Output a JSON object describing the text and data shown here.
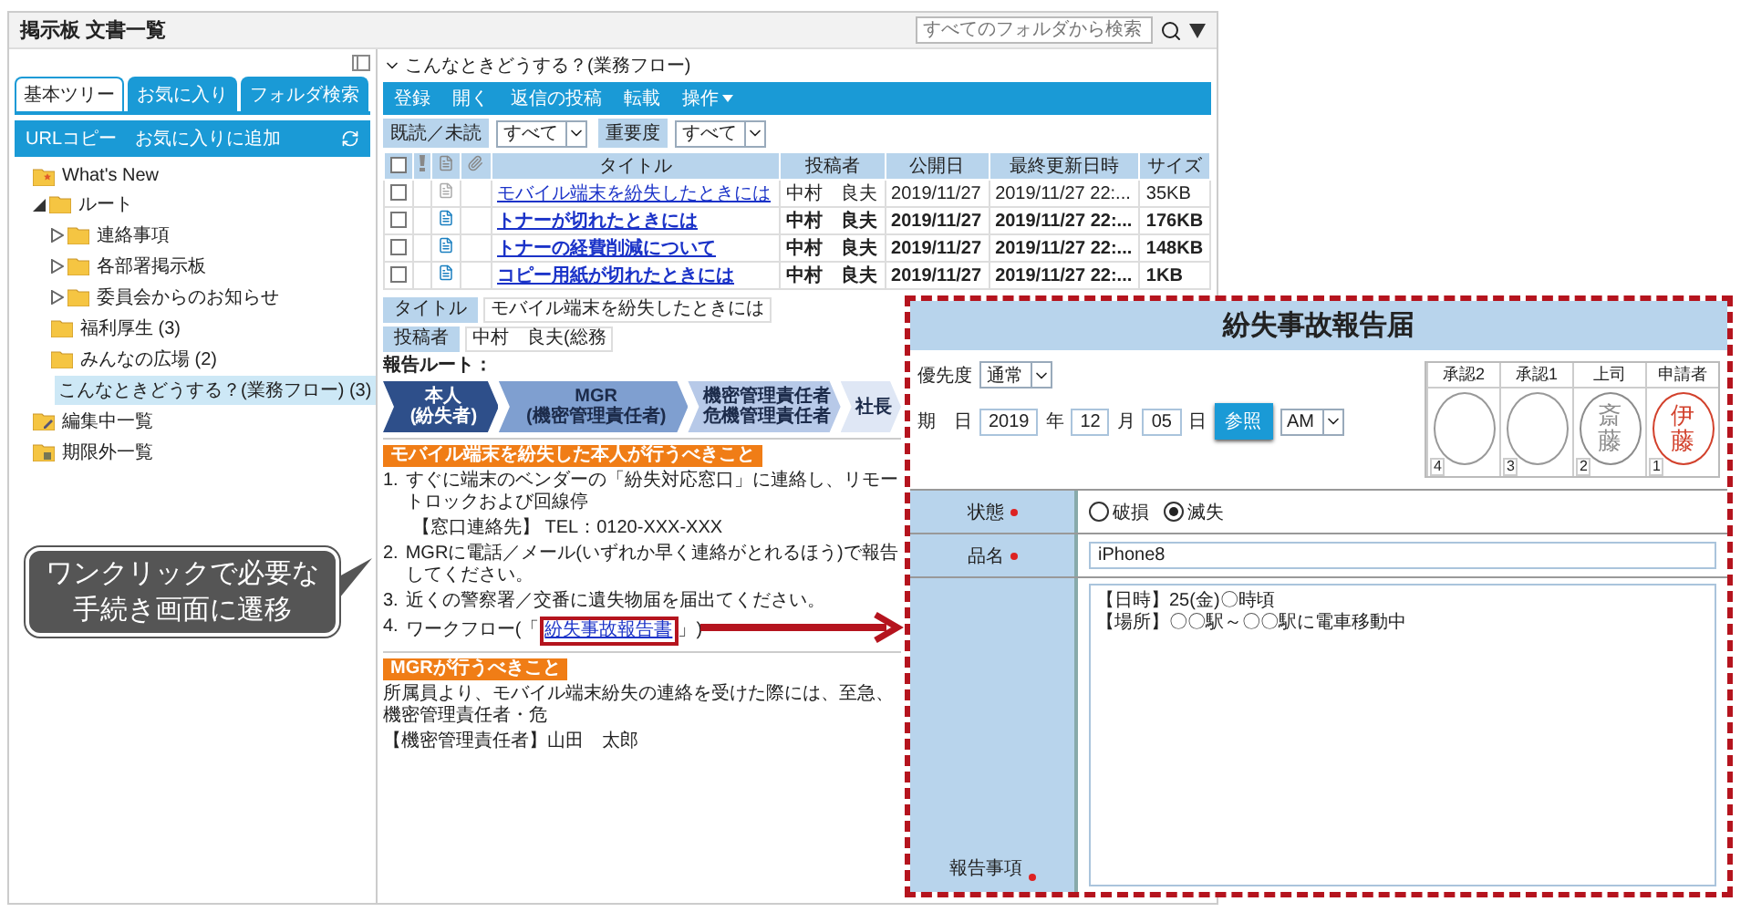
{
  "window": {
    "title": "掲示板 文書一覧",
    "search": {
      "placeholder": "すべてのフォルダから検索"
    }
  },
  "sidebar": {
    "tabs": [
      {
        "label": "基本ツリー",
        "selected": true
      },
      {
        "label": "お気に入り",
        "selected": false
      },
      {
        "label": "フォルダ検索",
        "selected": false
      }
    ],
    "actions": [
      "URLコピー",
      "お気に入りに追加"
    ],
    "tree": [
      {
        "label": "What's New",
        "kind": "news",
        "selected": false
      },
      {
        "label": "ルート",
        "kind": "folder",
        "expanded": true,
        "selected": false,
        "children": [
          {
            "label": "連絡事項",
            "kind": "folder",
            "expanded": false,
            "selected": false
          },
          {
            "label": "各部署掲示板",
            "kind": "folder",
            "expanded": false,
            "selected": false
          },
          {
            "label": "委員会からのお知らせ",
            "kind": "folder",
            "expanded": false,
            "selected": false
          },
          {
            "label": "福利厚生 (3)",
            "kind": "folder",
            "selected": false
          },
          {
            "label": "みんなの広場 (2)",
            "kind": "folder",
            "selected": false
          },
          {
            "label": "こんなときどうする？(業務フロー) (3)",
            "kind": "folder",
            "selected": true
          }
        ]
      },
      {
        "label": "編集中一覧",
        "kind": "editing",
        "selected": false
      },
      {
        "label": "期限外一覧",
        "kind": "expired",
        "selected": false
      }
    ]
  },
  "main": {
    "folder_title": "こんなときどうする？(業務フロー)",
    "toolbar": [
      {
        "label": "登録",
        "menu": false
      },
      {
        "label": "開く",
        "menu": false
      },
      {
        "label": "返信の投稿",
        "menu": false
      },
      {
        "label": "転載",
        "menu": false
      },
      {
        "label": "操作",
        "menu": true
      }
    ],
    "filters": [
      {
        "label": "既読／未読",
        "value": "すべて"
      },
      {
        "label": "重要度",
        "value": "すべて"
      }
    ],
    "table": {
      "select_all_checked": false,
      "columns": [
        "タイトル",
        "投稿者",
        "公開日",
        "最終更新日時",
        "サイズ"
      ],
      "rows": [
        {
          "checked": false,
          "unread": false,
          "title": "モバイル端末を紛失したときには",
          "author": "中村　良夫",
          "published": "2019/11/27",
          "updated": "2019/11/27 22:...",
          "size": "35KB"
        },
        {
          "checked": false,
          "unread": true,
          "title": "トナーが切れたときには",
          "author": "中村　良夫",
          "published": "2019/11/27",
          "updated": "2019/11/27 22:...",
          "size": "176KB"
        },
        {
          "checked": false,
          "unread": true,
          "title": "トナーの経費削減について",
          "author": "中村　良夫",
          "published": "2019/11/27",
          "updated": "2019/11/27 22:...",
          "size": "148KB"
        },
        {
          "checked": false,
          "unread": true,
          "title": "コピー用紙が切れたときには",
          "author": "中村　良夫",
          "published": "2019/11/27",
          "updated": "2019/11/27 22:...",
          "size": "1KB"
        }
      ]
    },
    "detail": {
      "fields": [
        {
          "label": "タイトル",
          "value": "モバイル端末を紛失したときには"
        },
        {
          "label": "投稿者",
          "value": "中村　良夫(総務"
        }
      ]
    },
    "route": {
      "label": "報告ルート：",
      "steps": [
        {
          "lines": [
            "本人",
            "(紛失者)"
          ],
          "color": "#2e4f8a"
        },
        {
          "lines": [
            "MGR",
            "(機密管理責任者)"
          ],
          "color": "#7f9fd0"
        },
        {
          "lines": [
            "機密管理責任者",
            "危機管理責任者"
          ],
          "color": "#b7c9e8"
        },
        {
          "lines": [
            "社長"
          ],
          "color": "#dfe7f5"
        }
      ]
    },
    "sections": [
      {
        "heading": "モバイル端末を紛失した本人が行うべきこと",
        "items": [
          {
            "number": "1.",
            "text": "すぐに端末のベンダーの「紛失対応窓口」に連絡し、リモートロックおよび回線停",
            "note": "【窓口連絡先】 TEL：0120-XXX-XXX"
          },
          {
            "number": "2.",
            "text": "MGRに電話／メール(いずれか早く連絡がとれるほう)で報告してください。"
          },
          {
            "number": "3.",
            "text": "近くの警察署／交番に遺失物届を届出てください。"
          },
          {
            "number": "4.",
            "text": "ワークフロー(「",
            "link": "紛失事故報告書",
            "after": "」)"
          }
        ]
      },
      {
        "heading": "MGRが行うべきこと",
        "paragraph": "所属員より、モバイル端末紛失の連絡を受けた際には、至急、機密管理責任者・危",
        "note": "【機密管理責任者】山田　太郎"
      }
    ]
  },
  "form": {
    "title": "紛失事故報告届",
    "priority": {
      "label": "優先度",
      "value": "通常"
    },
    "date": {
      "label": "期　日",
      "year": "2019",
      "year_unit": "年",
      "month": "12",
      "month_unit": "月",
      "day": "05",
      "day_unit": "日",
      "button": "参照",
      "ampm": "AM"
    },
    "stamps": [
      {
        "role": "承認2",
        "number": "4"
      },
      {
        "role": "承認1",
        "number": "3"
      },
      {
        "role": "上司",
        "number": "2",
        "seal": "斎藤",
        "color": "#8c8c8c"
      },
      {
        "role": "申請者",
        "number": "1",
        "seal": "伊藤",
        "color": "#d2412c"
      }
    ],
    "rows": [
      {
        "kind": "radio",
        "label": "状態",
        "required": true,
        "options": [
          {
            "label": "破損",
            "selected": false
          },
          {
            "label": "滅失",
            "selected": true
          }
        ]
      },
      {
        "kind": "input",
        "label": "品名",
        "required": true,
        "value": "iPhone8"
      },
      {
        "kind": "textarea",
        "label": "報告事項",
        "required": true,
        "lines": [
          "【日時】25(金)〇時頃",
          "【場所】〇〇駅～〇〇駅に電車移動中"
        ]
      }
    ]
  },
  "callout": {
    "lines": [
      "ワンクリックで必要な",
      "手続き画面に遷移"
    ]
  }
}
